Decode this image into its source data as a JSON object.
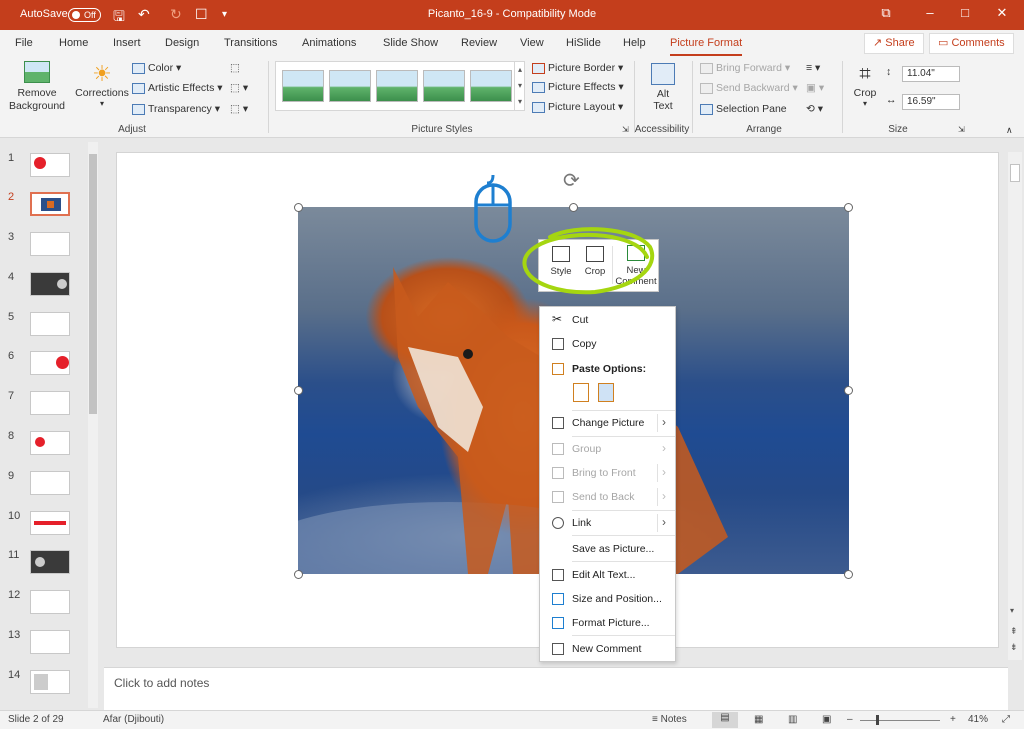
{
  "titlebar": {
    "autosave_label": "AutoSave",
    "autosave_state": "Off",
    "title": "Picanto_16-9  -  Compatibility Mode"
  },
  "tabs": [
    {
      "label": "File"
    },
    {
      "label": "Home"
    },
    {
      "label": "Insert"
    },
    {
      "label": "Design"
    },
    {
      "label": "Transitions"
    },
    {
      "label": "Animations"
    },
    {
      "label": "Slide Show"
    },
    {
      "label": "Review"
    },
    {
      "label": "View"
    },
    {
      "label": "HiSlide"
    },
    {
      "label": "Help"
    },
    {
      "label": "Picture Format"
    }
  ],
  "actions": {
    "share": "Share",
    "comments": "Comments"
  },
  "ribbon": {
    "remove_background": "Remove Background",
    "corrections": "Corrections",
    "color": "Color",
    "artistic_effects": "Artistic Effects",
    "transparency": "Transparency",
    "adjust_label": "Adjust",
    "picture_styles_label": "Picture Styles",
    "picture_border": "Picture Border",
    "picture_effects": "Picture Effects",
    "picture_layout": "Picture Layout",
    "alt_text": "Alt Text",
    "accessibility_label": "Accessibility",
    "bring_forward": "Bring Forward",
    "send_backward": "Send Backward",
    "selection_pane": "Selection Pane",
    "arrange_label": "Arrange",
    "crop": "Crop",
    "height": "11.04\"",
    "width": "16.59\"",
    "size_label": "Size"
  },
  "thumbnails": [
    "1",
    "2",
    "3",
    "4",
    "5",
    "6",
    "7",
    "8",
    "9",
    "10",
    "11",
    "12",
    "13",
    "14"
  ],
  "minitoolbar": {
    "style": "Style",
    "crop": "Crop",
    "new_comment": "New Comment"
  },
  "context_menu": {
    "cut": "Cut",
    "copy": "Copy",
    "paste_options": "Paste Options:",
    "change_picture": "Change Picture",
    "group": "Group",
    "bring_to_front": "Bring to Front",
    "send_to_back": "Send to Back",
    "link": "Link",
    "save_as_picture": "Save as Picture...",
    "edit_alt_text": "Edit Alt Text...",
    "size_and_position": "Size and Position...",
    "format_picture": "Format Picture...",
    "new_comment": "New Comment"
  },
  "notes": {
    "placeholder": "Click to add notes"
  },
  "status": {
    "slide": "Slide 2 of 29",
    "language": "Afar (Djibouti)",
    "notes": "Notes",
    "zoom": "41%"
  },
  "colors": {
    "accent": "#c43e1c",
    "highlight": "#a5d610",
    "mouse_icon": "#1e7fd0"
  }
}
